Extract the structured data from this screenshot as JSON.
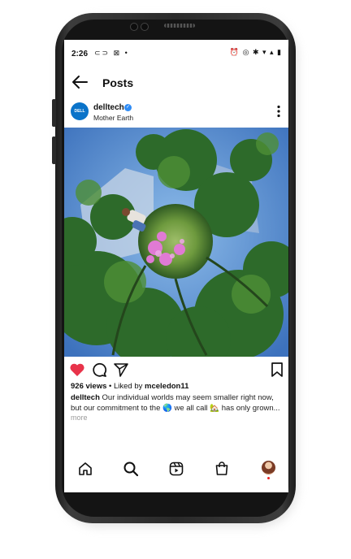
{
  "status_bar": {
    "time": "2:26",
    "left_icons": "⊂⊃ ⊠ •",
    "right_icons": "⏰ ◎ ✱ ▾ ▴ ▮"
  },
  "header": {
    "title": "Posts"
  },
  "post": {
    "username": "delltech",
    "avatar_text": "DELL",
    "location": "Mother Earth",
    "views_count": "926 views",
    "liked_by_prefix": " • Liked by ",
    "liked_by_user": "mceledon11",
    "caption_user": "delltech",
    "caption_text": " Our individual worlds may seem smaller right now, but our commitment to the 🌎 we all call 🏡 has only grown...",
    "more_label": "more"
  },
  "colors": {
    "like_red": "#e8334a",
    "verified_blue": "#2f8cf5"
  },
  "icons": {
    "back": "back-arrow-icon",
    "more": "more-options-icon",
    "like": "heart-icon",
    "comment": "comment-icon",
    "share": "send-icon",
    "save": "bookmark-icon",
    "home": "home-icon",
    "search": "search-icon",
    "reels": "reels-icon",
    "shop": "shop-icon"
  }
}
